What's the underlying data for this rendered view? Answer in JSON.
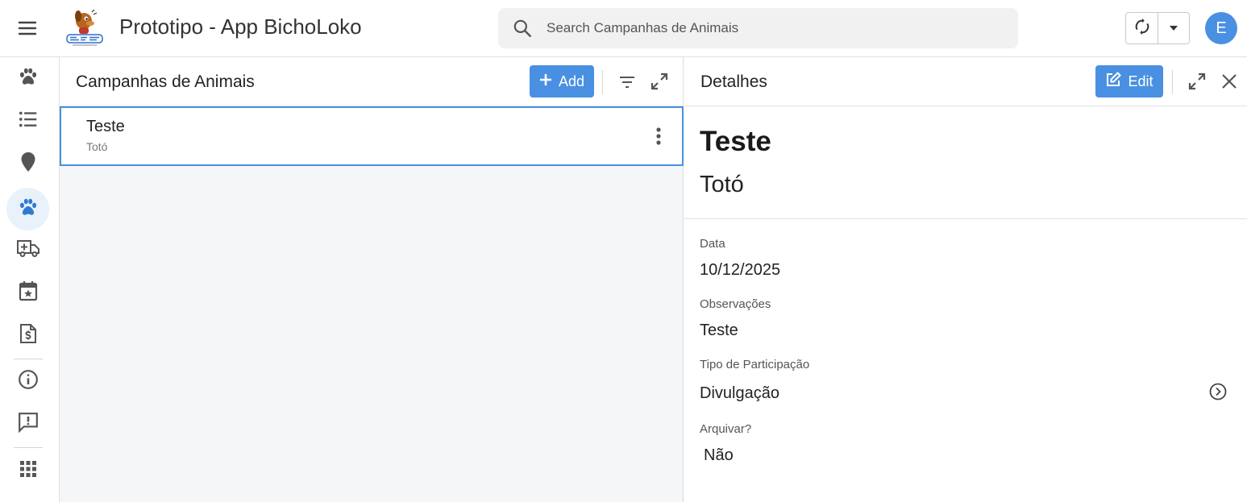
{
  "header": {
    "app_title": "Prototipo - App BichoLoko",
    "logo_text": "BichoLoko",
    "search_placeholder": "Search Campanhas de Animais",
    "search_value": "",
    "avatar_initial": "E"
  },
  "rail": {
    "items": [
      {
        "icon": "paw-icon",
        "active": false
      },
      {
        "icon": "list-icon",
        "active": false
      },
      {
        "icon": "map-pin-icon",
        "active": false
      },
      {
        "icon": "paw-icon",
        "active": true
      },
      {
        "icon": "ambulance-icon",
        "active": false
      },
      {
        "icon": "calendar-star-icon",
        "active": false
      },
      {
        "icon": "invoice-icon",
        "active": false
      },
      {
        "icon": "info-icon",
        "active": false
      },
      {
        "icon": "feedback-icon",
        "active": false
      },
      {
        "icon": "apps-grid-icon",
        "active": false
      }
    ]
  },
  "list_panel": {
    "title": "Campanhas de Animais",
    "add_label": "Add",
    "rows": [
      {
        "title": "Teste",
        "subtitle": "Totó"
      }
    ]
  },
  "detail_panel": {
    "title": "Detalhes",
    "edit_label": "Edit",
    "hero_title": "Teste",
    "hero_subtitle": "Totó",
    "fields": [
      {
        "label": "Data",
        "value": "10/12/2025"
      },
      {
        "label": "Observações",
        "value": "Teste"
      },
      {
        "label": "Tipo de Participação",
        "value": "Divulgação"
      },
      {
        "label": "Arquivar?",
        "value": "Não"
      }
    ]
  },
  "colors": {
    "accent": "#4a90e2",
    "rail_active_bg": "#e9f1fb",
    "icon_gray": "#555555",
    "list_bg": "#f5f6f8"
  }
}
